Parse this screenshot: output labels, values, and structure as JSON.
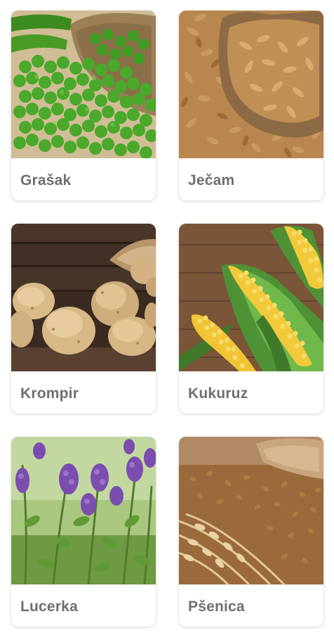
{
  "crops": [
    {
      "label": "Grašak",
      "image": "peas-photo"
    },
    {
      "label": "Ječam",
      "image": "barley-photo"
    },
    {
      "label": "Krompir",
      "image": "potato-photo"
    },
    {
      "label": "Kukuruz",
      "image": "corn-photo"
    },
    {
      "label": "Lucerka",
      "image": "alfalfa-photo"
    },
    {
      "label": "Pšenica",
      "image": "wheat-photo"
    }
  ],
  "colors": {
    "label_text": "#6f6f6f",
    "card_background": "#ffffff"
  }
}
